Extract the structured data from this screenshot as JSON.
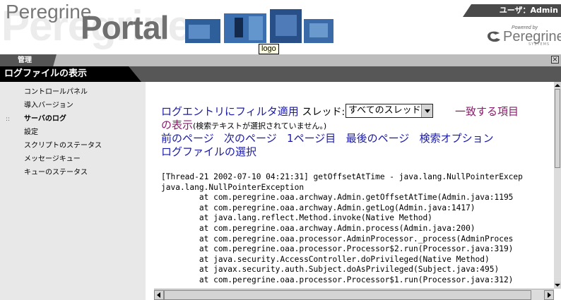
{
  "header": {
    "brand_background": "Peregrine",
    "brand_word": "Peregrine",
    "brand_portal": "Portal",
    "logo_tooltip": "logo",
    "user_label": "ユーザ：Admin",
    "powered_by": "Powered by",
    "powered_name": "Peregrine",
    "powered_sub": "SYSTEMS"
  },
  "admin_tab": {
    "label": "管理"
  },
  "page_title": "ログファイルの表示",
  "sidebar": {
    "items": [
      {
        "label": "コントロールパネル",
        "active": false
      },
      {
        "label": "導入バージョン",
        "active": false
      },
      {
        "label": "サーバのログ",
        "active": true
      },
      {
        "label": "設定",
        "active": false
      },
      {
        "label": "スクリプトのステータス",
        "active": false
      },
      {
        "label": "メッセージキュー",
        "active": false
      },
      {
        "label": "キューのステータス",
        "active": false
      }
    ],
    "active_bullet": "::"
  },
  "main": {
    "filter_link": "ログエントリにフィルタ適用",
    "thread_label": "スレッド:",
    "thread_select": "すべてのスレッド",
    "match_link_a": "一致する項目",
    "match_link_b": "の表示",
    "no_search_text": "(検索テキストが選択されていません。)",
    "nav_prev": "前のページ",
    "nav_next": "次のページ",
    "nav_first": "1ページ目",
    "nav_last": "最後のページ",
    "nav_search": "検索オプション",
    "select_logfile": "ログファイルの選択",
    "log_lines": [
      "[Thread-21 2002-07-10 04:21:31] getOffsetAtTime - java.lang.NullPointerExcep",
      "java.lang.NullPointerException",
      "        at com.peregrine.oaa.archway.Admin.getOffsetAtTime(Admin.java:1195",
      "        at com.peregrine.oaa.archway.Admin.getLog(Admin.java:1417)",
      "        at java.lang.reflect.Method.invoke(Native Method)",
      "        at com.peregrine.oaa.archway.Admin.process(Admin.java:200)",
      "        at com.peregrine.oaa.processor.AdminProcessor._process(AdminProces",
      "        at com.peregrine.oaa.processor.Processor$2.run(Processor.java:319)",
      "        at java.security.AccessController.doPrivileged(Native Method)",
      "        at javax.security.auth.Subject.doAsPrivileged(Subject.java:495)",
      "        at com.peregrine.oaa.processor.Processor$1.run(Processor.java:312)"
    ]
  },
  "colors": {
    "link_blue": "#1a1aa6",
    "link_magenta": "#8b1a6b",
    "title_bar": "#000000",
    "sidebar_bg": "#e8e8e8"
  }
}
